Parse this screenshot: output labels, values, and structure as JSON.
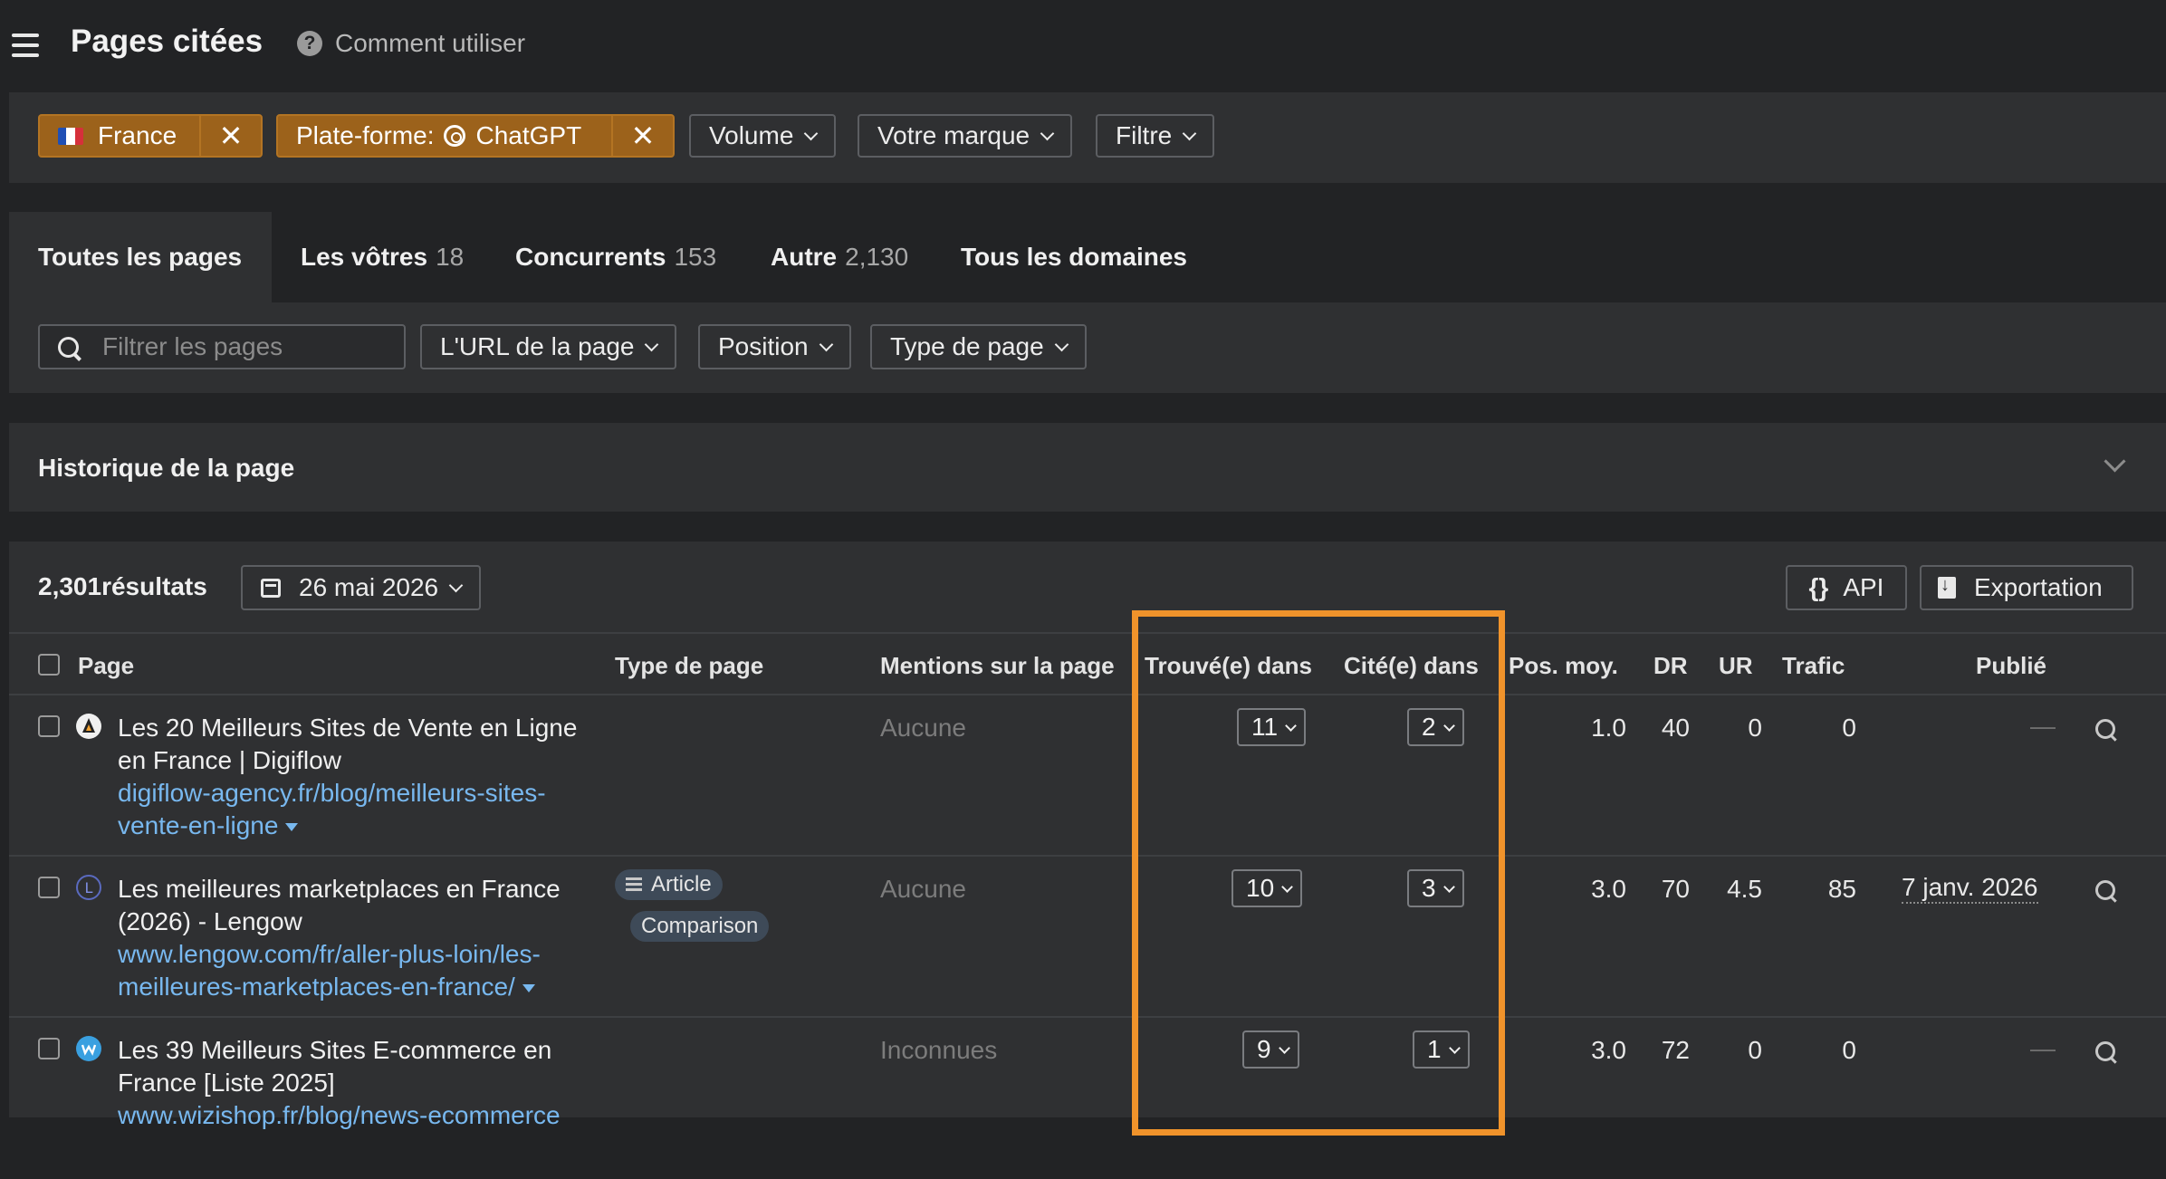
{
  "header": {
    "title": "Pages citées",
    "help_label": "Comment utiliser"
  },
  "filters": {
    "country": "France",
    "platform_label": "Plate-forme:",
    "platform_value": "ChatGPT",
    "remove_icon": "✕",
    "volume": "Volume",
    "brand": "Votre marque",
    "filter": "Filtre"
  },
  "tabs": [
    {
      "label": "Toutes les pages",
      "count": ""
    },
    {
      "label": "Les vôtres",
      "count": "18"
    },
    {
      "label": "Concurrents",
      "count": "153"
    },
    {
      "label": "Autre",
      "count": "2,130"
    },
    {
      "label": "Tous les domaines",
      "count": ""
    }
  ],
  "subfilters": {
    "search_placeholder": "Filtrer les pages",
    "url": "L'URL de la page",
    "position": "Position",
    "page_type": "Type de page"
  },
  "history": {
    "title": "Historique de la page"
  },
  "results": {
    "count": "2,301résultats",
    "date": "26 mai 2026",
    "api": "API",
    "export": "Exportation"
  },
  "columns": {
    "page": "Page",
    "page_type": "Type de page",
    "mentions": "Mentions sur la page",
    "found": "Trouvé(e) dans",
    "cited": "Cité(e) dans",
    "pos": "Pos. moy.",
    "dr": "DR",
    "ur": "UR",
    "traffic": "Trafic",
    "published": "Publié"
  },
  "rows": [
    {
      "title": "Les 20 Meilleurs Sites de Vente en Ligne en France | Digiflow",
      "url": "digiflow-agency.fr/blog/meilleurs-sites-vente-en-ligne",
      "types": [],
      "mentions": "Aucune",
      "found": "11",
      "cited": "2",
      "pos": "1.0",
      "dr": "40",
      "ur": "0",
      "traffic": "0",
      "published": "—"
    },
    {
      "title": "Les meilleures marketplaces en France (2026) - Lengow",
      "url": "www.lengow.com/fr/aller-plus-loin/les-meilleures-marketplaces-en-france/",
      "types": [
        "Article",
        "Comparison"
      ],
      "mentions": "Aucune",
      "found": "10",
      "cited": "3",
      "pos": "3.0",
      "dr": "70",
      "ur": "4.5",
      "traffic": "85",
      "published": "7 janv. 2026"
    },
    {
      "title": "Les 39 Meilleurs Sites E-commerce en France [Liste 2025]",
      "url": "www.wizishop.fr/blog/news-ecommerce",
      "types": [],
      "mentions": "Inconnues",
      "found": "9",
      "cited": "1",
      "pos": "3.0",
      "dr": "72",
      "ur": "0",
      "traffic": "0",
      "published": "—"
    }
  ],
  "colors": {
    "accent_orange": "#f0932b",
    "chip_orange": "#9c621b",
    "link_blue": "#78b8ef"
  }
}
